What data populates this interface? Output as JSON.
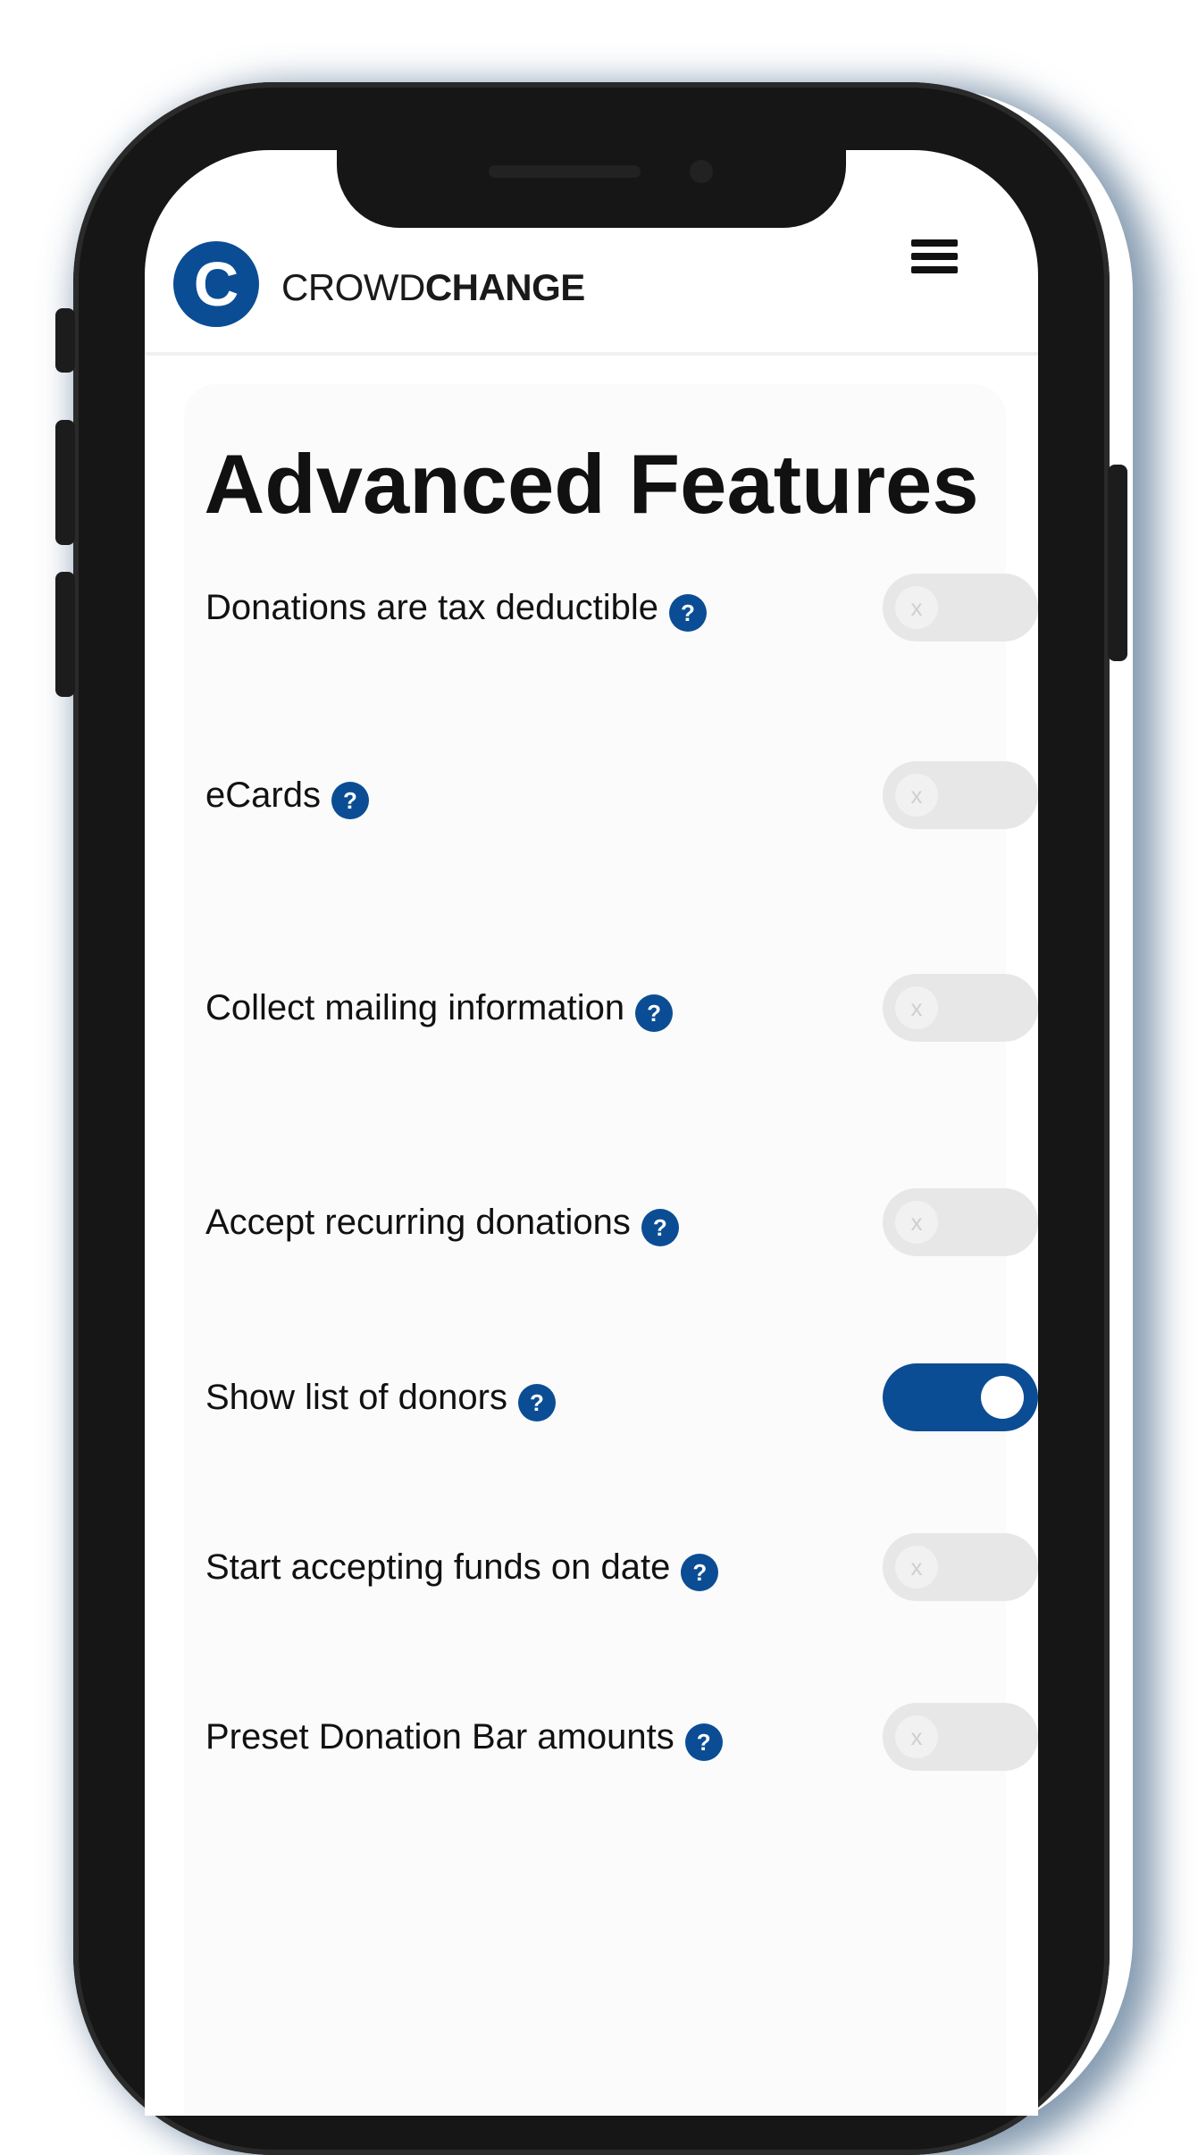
{
  "brand": {
    "logo_letter": "C",
    "name_light": "CROWD",
    "name_bold": "CHANGE",
    "accent_color": "#0b4d94"
  },
  "header": {
    "menu_icon": "hamburger-menu-icon"
  },
  "page": {
    "title": "Advanced Features"
  },
  "features": [
    {
      "label": "Donations are tax deductible",
      "help": "?",
      "enabled": false,
      "toggle_glyph": "x"
    },
    {
      "label": "eCards",
      "help": "?",
      "enabled": false,
      "toggle_glyph": "x"
    },
    {
      "label": "Collect mailing information",
      "help": "?",
      "enabled": false,
      "toggle_glyph": "x"
    },
    {
      "label": "Accept recurring donations",
      "help": "?",
      "enabled": false,
      "toggle_glyph": "x"
    },
    {
      "label": "Show list of donors",
      "help": "?",
      "enabled": true,
      "toggle_glyph": ""
    },
    {
      "label": "Start accepting funds on date",
      "help": "?",
      "enabled": false,
      "toggle_glyph": "x"
    },
    {
      "label": "Preset Donation Bar amounts",
      "help": "?",
      "enabled": false,
      "toggle_glyph": "x"
    }
  ]
}
